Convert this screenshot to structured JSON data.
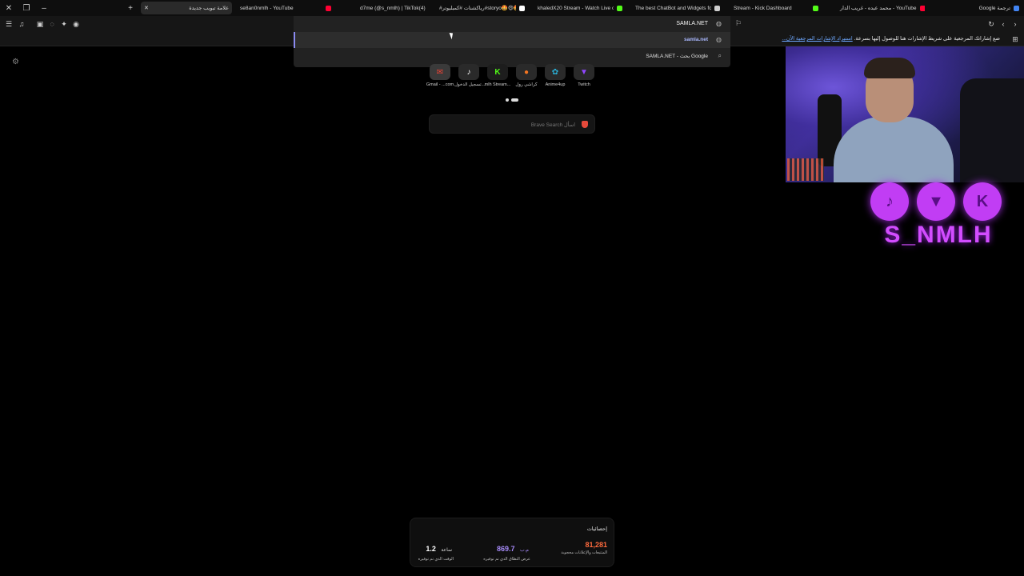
{
  "colors": {
    "page_background": "#000000",
    "chrome_background": "#161616",
    "accent_purple": "#c13df4",
    "stat_orange": "#ff6a3d",
    "stat_purple": "#a78bfa"
  },
  "tabs": [
    {
      "title": "علامة تبويب جديدة",
      "icon": "brave-icon",
      "active": true
    },
    {
      "title": "se8an0nmlh - YouTube",
      "icon": "youtube-icon"
    },
    {
      "title": "d7me (@s_nmlh) | TikTok(4)",
      "icon": "tiktok-icon"
    },
    {
      "title": "#رياكشنات #كمبليوتر#storyo🤩😄🤩 ...",
      "icon": "tiktok-icon"
    },
    {
      "title": "khaledX20 Stream - Watch Live o...",
      "icon": "kick-icon"
    },
    {
      "title": "The best ChatBot and Widgets fo...",
      "icon": "streamelements-icon"
    },
    {
      "title": "Stream - Kick Dashboard",
      "icon": "kick-icon"
    },
    {
      "title": "محمد عبده - غريب الدار - YouTube",
      "icon": "youtube-icon"
    },
    {
      "title": "Google ترجمة",
      "icon": "translate-icon"
    }
  ],
  "omnibox": {
    "value": "SAMLA.NET",
    "suggestions": [
      {
        "text": "samla.net",
        "icon": "globe-icon",
        "selected": true
      },
      {
        "text": "SAMLA.NET - بحث Google",
        "icon": "search-icon",
        "selected": false
      }
    ]
  },
  "bookmarks_bar": {
    "prompt": "ضع إشاراتك المرجعية على شريط الإشارات هنا للوصول إليها بسرعة.",
    "import_link": "استيراد الإشارات المرجعية الآن..."
  },
  "top_sites": [
    {
      "label": "Twitch",
      "icon": "twitch-icon",
      "color": "#9146ff"
    },
    {
      "label": "Anime4up",
      "icon": "anime-icon",
      "color": "#2ab1d8"
    },
    {
      "label": "كراشي رول",
      "icon": "crunchyroll-icon",
      "color": "#f47521"
    },
    {
      "label": "mlh Stream...",
      "icon": "kick-icon",
      "color": "#53fc18"
    },
    {
      "label": "تسجيل الدخول...",
      "icon": "tiktok-icon",
      "color": "#1a1a1a"
    },
    {
      "label": "Gmail - ...com",
      "icon": "gmail-icon",
      "color": "#e8e8e8"
    }
  ],
  "search": {
    "placeholder": "اسأل Brave Search"
  },
  "overlay": {
    "channel_name": "S_NMLH",
    "socials": [
      {
        "name": "TikTok",
        "icon": "tiktok-logo-icon"
      },
      {
        "name": "Twitch",
        "icon": "twitch-logo-icon"
      },
      {
        "name": "Kick",
        "icon": "kick-logo-icon"
      }
    ]
  },
  "stats": {
    "title": "إحصائيات",
    "items": [
      {
        "value": "81,281",
        "unit": "",
        "label": "المتتبعات والإعلانات محجوبة",
        "color": "#ff6a3d"
      },
      {
        "value": "869.7",
        "unit": "م.ب",
        "label": "عرض النطاق الذي تم توفيره",
        "color": "#a78bfa"
      },
      {
        "value": "1.2",
        "unit": "ساعة",
        "label": "الوقت الذي تم توفيره",
        "color": "#ffffff"
      }
    ]
  }
}
